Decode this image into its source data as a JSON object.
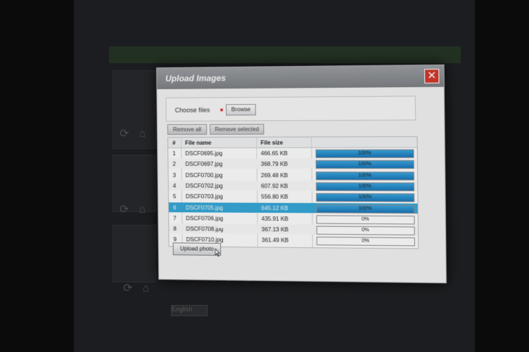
{
  "dialog": {
    "title": "Upload Images",
    "choose_label": "Choose files",
    "browse_label": "Browse",
    "remove_all_label": "Remove all",
    "remove_selected_label": "Remove selected",
    "upload_label": "Upload photo"
  },
  "table": {
    "headers": [
      "#",
      "File name",
      "File size",
      ""
    ],
    "rows": [
      {
        "num": "1",
        "name": "DSCF0695.jpg",
        "size": "466.65 KB",
        "progress": "100%",
        "fraction": 1.0
      },
      {
        "num": "2",
        "name": "DSCF0697.jpg",
        "size": "368.79 KB",
        "progress": "100%",
        "fraction": 1.0
      },
      {
        "num": "3",
        "name": "DSCF0700.jpg",
        "size": "269.48 KB",
        "progress": "100%",
        "fraction": 1.0
      },
      {
        "num": "4",
        "name": "DSCF0702.jpg",
        "size": "607.92 KB",
        "progress": "100%",
        "fraction": 1.0
      },
      {
        "num": "5",
        "name": "DSCF0703.jpg",
        "size": "556.80 KB",
        "progress": "100%",
        "fraction": 1.0
      },
      {
        "num": "6",
        "name": "DSCF0705.jpg",
        "size": "645.12 KB",
        "progress": "100%",
        "fraction": 1.0
      },
      {
        "num": "7",
        "name": "DSCF0706.jpg",
        "size": "435.91 KB",
        "progress": "0%",
        "fraction": 0.0
      },
      {
        "num": "8",
        "name": "DSCF0708.jpg",
        "size": "367.13 KB",
        "progress": "0%",
        "fraction": 0.0
      },
      {
        "num": "9",
        "name": "DSCF0710.jpg",
        "size": "361.49 KB",
        "progress": "0%",
        "fraction": 0.0
      }
    ],
    "selected_row": 6
  },
  "background": {
    "language_select": "English"
  },
  "colors": {
    "accent": "#36a9d8",
    "progress": "#1b78bb",
    "close": "#d4372c"
  },
  "icons": [
    "close-icon",
    "refresh-icon",
    "home-icon",
    "cursor-icon"
  ]
}
